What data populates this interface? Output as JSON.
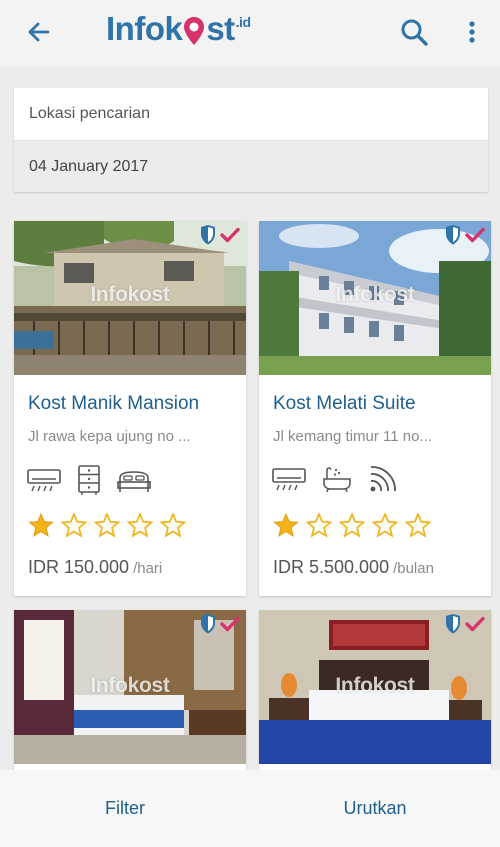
{
  "header": {
    "logo_text": "Infok",
    "logo_text_end": "st",
    "logo_tld": ".id",
    "back_icon": "arrow-left-icon",
    "search_icon": "search-icon",
    "more_icon": "more-vert-icon",
    "brand_color": "#2f73a8",
    "accent_color": "#d6336c"
  },
  "search": {
    "location_placeholder": "Lokasi pencarian",
    "date": "04 January 2017"
  },
  "watermark": "Infokost",
  "listings": [
    {
      "name": "Kost Manik Mansion",
      "address": "Jl rawa kepa ujung no ...",
      "facilities": [
        "ac-icon",
        "wardrobe-icon",
        "bed-icon"
      ],
      "rating": 1,
      "rating_max": 5,
      "price": "IDR 150.000",
      "unit": "/hari"
    },
    {
      "name": "Kost Melati Suite",
      "address": "Jl kemang timur 11 no...",
      "facilities": [
        "ac-icon",
        "bathtub-icon",
        "wifi-icon"
      ],
      "rating": 1,
      "rating_max": 5,
      "price": "IDR 5.500.000",
      "unit": "/bulan"
    },
    {},
    {}
  ],
  "bottom_bar": {
    "filter_label": "Filter",
    "sort_label": "Urutkan"
  }
}
